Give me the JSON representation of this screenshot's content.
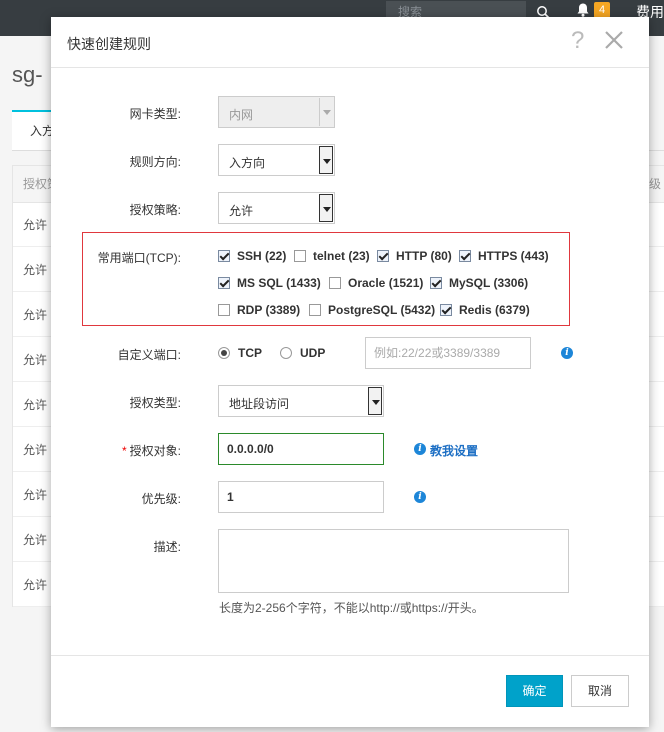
{
  "background": {
    "search_placeholder": "搜索",
    "notification_count": "4",
    "fee_label": "费用",
    "page_title": "sg-",
    "tab_label": "入方",
    "table_header_first": "授权策",
    "table_header_last": "级",
    "rows": [
      "允许",
      "允许",
      "允许",
      "允许",
      "允许",
      "允许",
      "允许",
      "允许",
      "允许"
    ]
  },
  "dialog": {
    "title": "快速创建规则",
    "help_symbol": "?",
    "nic_type": {
      "label": "网卡类型:",
      "value": "内网"
    },
    "direction": {
      "label": "规则方向:",
      "value": "入方向"
    },
    "policy": {
      "label": "授权策略:",
      "value": "允许"
    },
    "common_ports": {
      "label": "常用端口(TCP):",
      "options": [
        {
          "label": "SSH (22)",
          "checked": true
        },
        {
          "label": "telnet (23)",
          "checked": false
        },
        {
          "label": "HTTP (80)",
          "checked": true
        },
        {
          "label": "HTTPS (443)",
          "checked": true
        },
        {
          "label": "MS SQL (1433)",
          "checked": true
        },
        {
          "label": "Oracle (1521)",
          "checked": false
        },
        {
          "label": "MySQL (3306)",
          "checked": true
        },
        {
          "label": "RDP (3389)",
          "checked": false
        },
        {
          "label": "PostgreSQL (5432)",
          "checked": false
        },
        {
          "label": "Redis (6379)",
          "checked": true
        }
      ]
    },
    "custom_port": {
      "label": "自定义端口:",
      "protocols": [
        "TCP",
        "UDP"
      ],
      "selected_protocol": "TCP",
      "placeholder": "例如:22/22或3389/3389"
    },
    "auth_type": {
      "label": "授权类型:",
      "value": "地址段访问"
    },
    "auth_object": {
      "required_mark": "*",
      "label": "授权对象:",
      "value": "0.0.0.0/0",
      "help_link": "教我设置"
    },
    "priority": {
      "label": "优先级:",
      "value": "1"
    },
    "description": {
      "label": "描述:",
      "value": "",
      "hint": "长度为2-256个字符，不能以http://或https://开头。"
    },
    "buttons": {
      "confirm": "确定",
      "cancel": "取消"
    }
  },
  "colors": {
    "primary": "#00a2ca",
    "highlight_border": "#e0383e",
    "valid_border": "#2b8a2b",
    "link": "#1d6fc4",
    "info_icon": "#1d86d8",
    "badge": "#f5a623",
    "topbar": "#373d41"
  }
}
